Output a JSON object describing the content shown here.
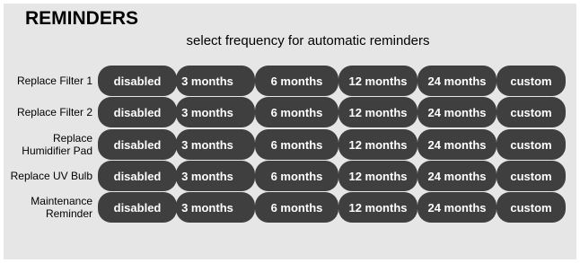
{
  "header": {
    "title": "REMINDERS",
    "subtitle": "select frequency for automatic reminders"
  },
  "options": [
    "disabled",
    "3 months",
    "6 months",
    "12 months",
    "24 months",
    "custom"
  ],
  "rows": [
    {
      "label": "Replace Filter 1"
    },
    {
      "label": "Replace Filter 2"
    },
    {
      "label": "Replace\nHumidifier Pad"
    },
    {
      "label": "Replace UV Bulb"
    },
    {
      "label": "Maintenance\nReminder"
    }
  ],
  "colors": {
    "panel_bg": "#e6e6e6",
    "button_bg": "#3f3f3f",
    "button_text": "#ffffff"
  }
}
